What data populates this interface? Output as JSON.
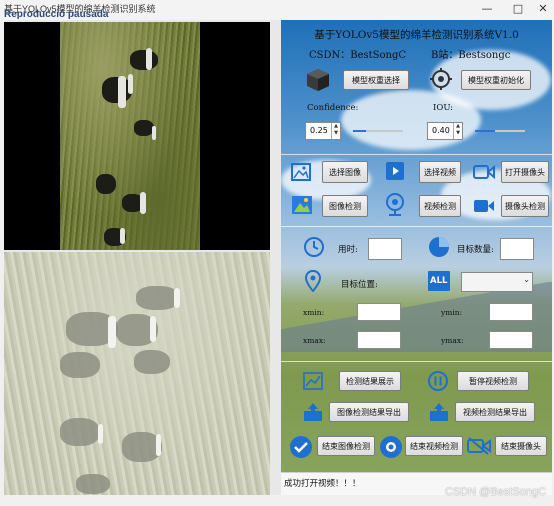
{
  "window": {
    "title": "基于YOLOv5模型的绵羊检测识别系统",
    "overlay_badge": "Reproducció pausada",
    "controls": {
      "minimize": "—",
      "maximize": "□",
      "close": "✕"
    }
  },
  "panel": {
    "title": "基于YOLOv5模型的绵羊检测识别系统V1.0",
    "csdn": "CSDN：BestSongC",
    "bilibili": "B站：Bestsongc",
    "model_select_label": "模型权重选择",
    "model_init_label": "模型权重初始化",
    "confidence_label": "Confidence:",
    "iou_label": "IOU:",
    "confidence_value": "0.25",
    "iou_value": "0.40",
    "confidence_level": 0.25,
    "iou_level": 0.4
  },
  "actions": {
    "select_image": "选择图像",
    "select_video": "选择视频",
    "open_camera": "打开摄像头",
    "image_detect": "图像检测",
    "video_detect": "视频检测",
    "camera_detect": "摄像头检测"
  },
  "info": {
    "time_label": "用时:",
    "count_label": "目标数量:",
    "position_label": "目标位置:",
    "xmin_label": "xmin:",
    "ymin_label": "ymin:",
    "xmax_label": "xmax:",
    "ymax_label": "ymax:",
    "all_badge": "ALL"
  },
  "bottom": {
    "show_result": "检测结果展示",
    "pause_video": "暂停视频检测",
    "export_image": "图像检测结果导出",
    "export_video": "视频检测结果导出",
    "end_image": "结束图像检测",
    "end_video": "结束视频检测",
    "end_camera": "结束摄像头"
  },
  "status": {
    "text": "成功打开视频！！！"
  },
  "watermark": "CSDN @BestSongC",
  "colors": {
    "accent": "#2f6fd6",
    "icon_blue": "#1f6fd0"
  }
}
